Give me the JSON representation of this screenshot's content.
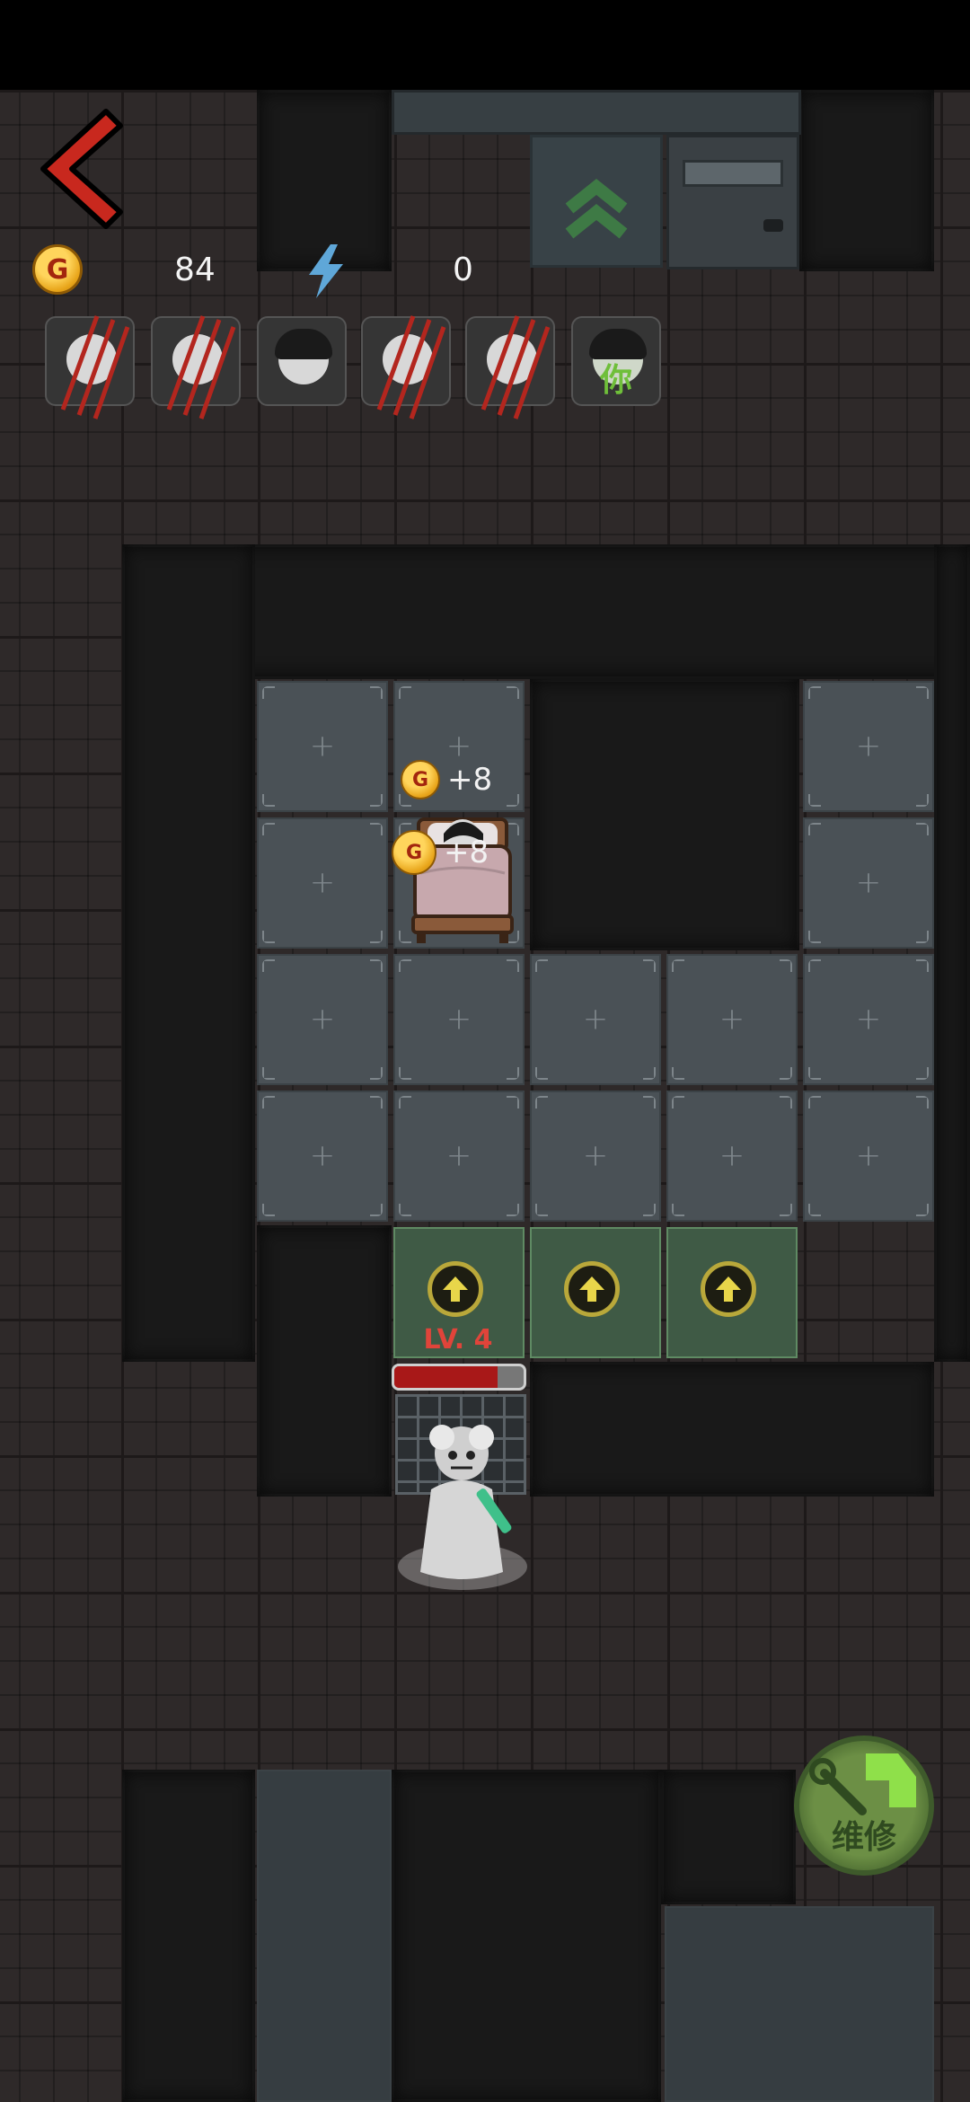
{
  "hud": {
    "gold_amount": "84",
    "energy_amount": "0",
    "coin_letter": "G"
  },
  "teammates": [
    {
      "name": "slot-1",
      "status": "attacked"
    },
    {
      "name": "slot-2",
      "status": "attacked"
    },
    {
      "name": "slot-3",
      "status": "normal"
    },
    {
      "name": "slot-4",
      "status": "attacked"
    },
    {
      "name": "slot-5",
      "status": "attacked"
    },
    {
      "name": "slot-6",
      "status": "you",
      "label": "你"
    }
  ],
  "room": {
    "gain_1": "+8",
    "gain_2": "+8"
  },
  "enemy": {
    "level_label": "LV. 4",
    "hp_fraction": 0.8
  },
  "repair_button": {
    "label": "维修"
  },
  "colors": {
    "accent_red": "#c8281e",
    "upgrade_yellow": "#b9a83a",
    "repair_green": "#6c8f45",
    "you_green": "#6fbf3a"
  },
  "icons": {
    "back": "chevron-left-icon",
    "gold": "coin-icon",
    "energy": "lightning-icon",
    "door_up": "double-chevron-up-icon",
    "upgrade": "arrow-up-icon",
    "repair": "wrench-gear-icon"
  }
}
